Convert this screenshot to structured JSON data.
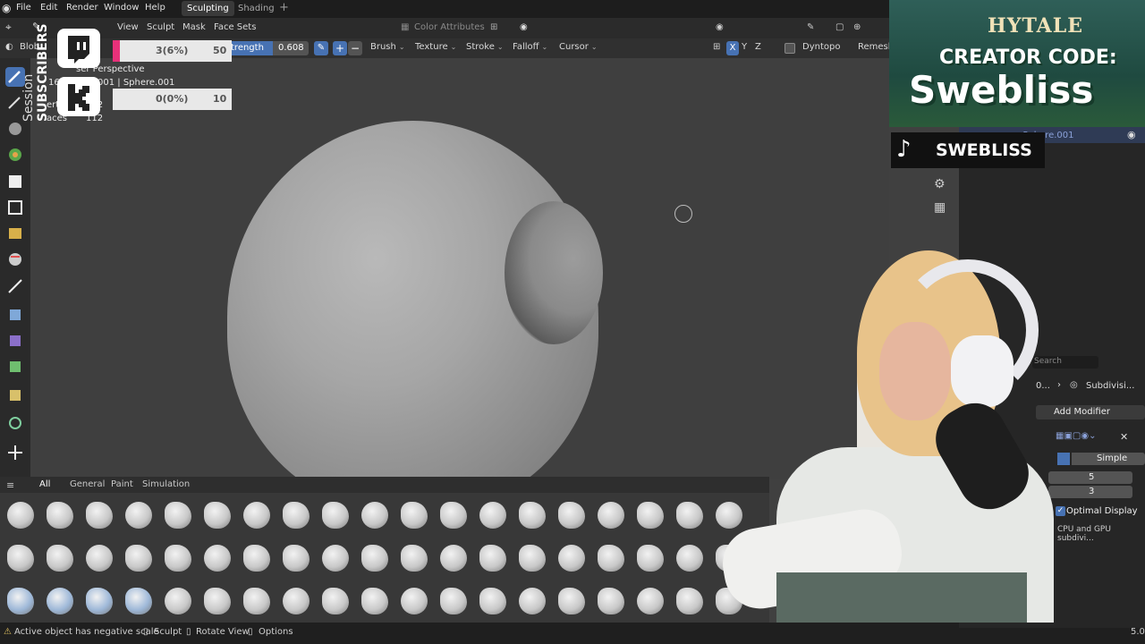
{
  "menubar": {
    "items": [
      "File",
      "Edit",
      "Render",
      "Window",
      "Help"
    ],
    "workspaces": [
      "Sculpting",
      "Shading"
    ],
    "add_tab": "+"
  },
  "header": {
    "object_name": "Blob",
    "menus": [
      "View",
      "Sculpt",
      "Mask",
      "Face Sets"
    ],
    "color_attributes": "Color Attributes"
  },
  "toolheader": {
    "strength_label": "trength",
    "strength_value": "0.608",
    "menus": [
      "Brush",
      "Texture",
      "Stroke",
      "Falloff",
      "Cursor"
    ],
    "axes": [
      "X",
      "Y",
      "Z"
    ],
    "dyntopo": "Dyntopo",
    "remesh": "Remesh"
  },
  "viewport": {
    "perspective": "ser Perspective",
    "object_info": "001 | Sphere.001",
    "line1_prefix": "16",
    "line3": "erties",
    "line3_val": "112",
    "line4": "aces",
    "line4_val": "112"
  },
  "overlay": {
    "vertical_text_1": "Session",
    "vertical_text_2": "SUBSCRIBERS",
    "goal1_text": "3(6%)",
    "goal1_max": "50",
    "goal2_text": "0(0%)",
    "goal2_max": "10",
    "banner_line1": "HYTALE",
    "banner_line2": "CREATOR CODE:",
    "banner_line3": "Swebliss",
    "tiktok_name": "SWEBLISS"
  },
  "shelf": {
    "tabs": [
      "All",
      "General",
      "Paint",
      "Simulation"
    ],
    "active_tab": "All"
  },
  "rightpanel": {
    "object_label": "Sphere.001",
    "search_placeholder": "Search",
    "modifier_name": "Subdivisi...",
    "modifier_prefix": "0...",
    "add_modifier": "Add Modifier",
    "simple": "Simple",
    "levels_viewport": "5",
    "levels_render": "3",
    "optimal_display": "Optimal Display",
    "gpu_text": "CPU and GPU subdivi..."
  },
  "statusbar": {
    "warning": "Active object has negative scale",
    "sculpt": "Sculpt",
    "rotate": "Rotate View",
    "options": "Options",
    "version": "5.0"
  },
  "colors": {
    "accent_blue": "#4772b3",
    "pink": "#e8317a",
    "brush_bg": "#4a4a4a"
  }
}
